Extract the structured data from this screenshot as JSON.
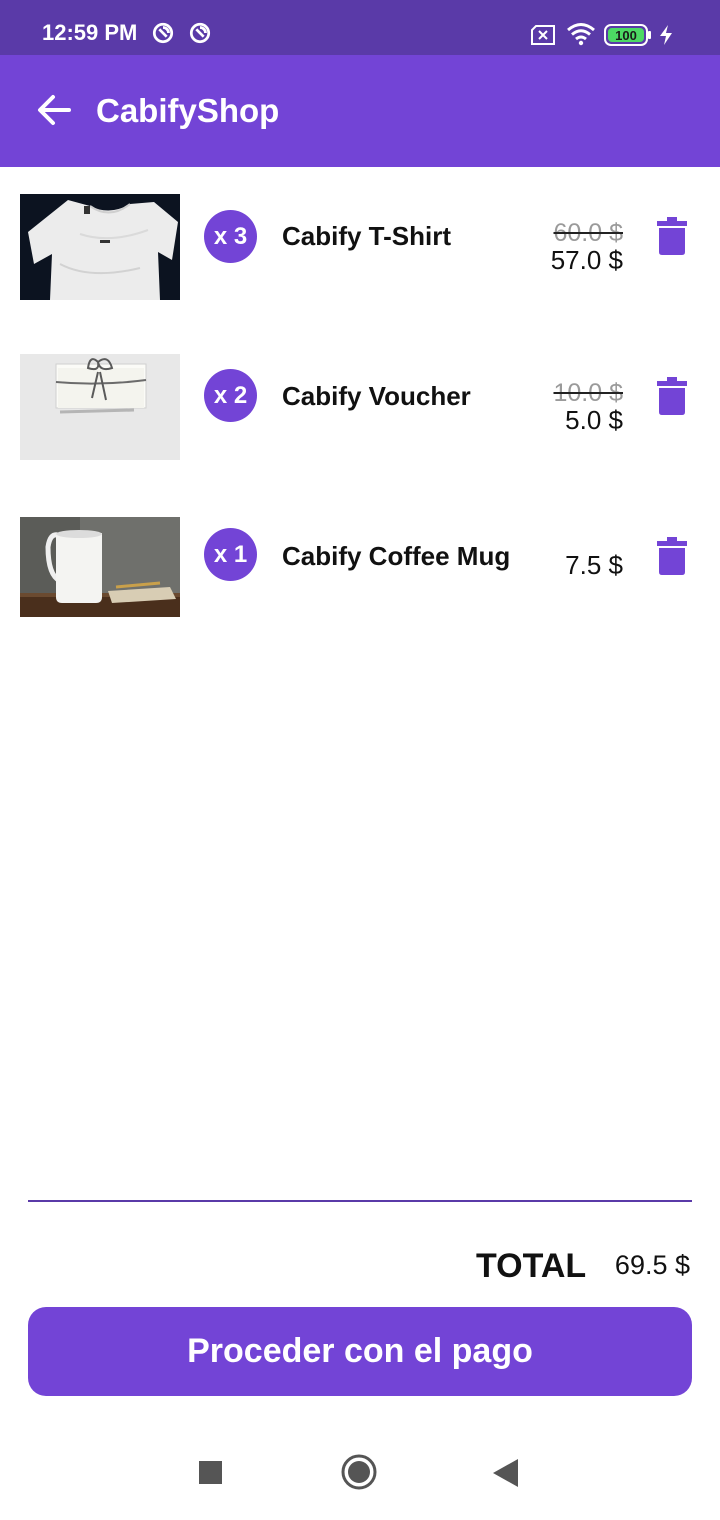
{
  "status_bar": {
    "time": "12:59 PM",
    "battery": "100",
    "icons": [
      "app-notification-icon",
      "app-notification-icon",
      "sim-off-icon",
      "wifi-icon",
      "battery-icon",
      "charging-icon"
    ]
  },
  "app_bar": {
    "title": "CabifyShop",
    "back_icon": "arrow-back-icon",
    "color": "#7344d6"
  },
  "cart": {
    "items": [
      {
        "quantity": "x 3",
        "name": "Cabify T-Shirt",
        "old_price": "60.0 $",
        "price": "57.0 $",
        "image": "white-tshirt-photo",
        "delete_icon": "trash-icon"
      },
      {
        "quantity": "x 2",
        "name": "Cabify Voucher",
        "old_price": "10.0 $",
        "price": "5.0 $",
        "image": "voucher-envelope-photo",
        "delete_icon": "trash-icon"
      },
      {
        "quantity": "x 1",
        "name": "Cabify Coffee Mug",
        "old_price": "",
        "price": "7.5 $",
        "image": "coffee-mug-photo",
        "delete_icon": "trash-icon"
      }
    ]
  },
  "summary": {
    "total_label": "TOTAL",
    "total_value": "69.5 $"
  },
  "checkout_button": {
    "label": "Proceder con el pago"
  },
  "nav_bar": {
    "icons": [
      "recents-square-icon",
      "home-circle-icon",
      "back-triangle-icon"
    ]
  },
  "colors": {
    "accent": "#7344d6",
    "status_bar": "#5a3aa8"
  }
}
